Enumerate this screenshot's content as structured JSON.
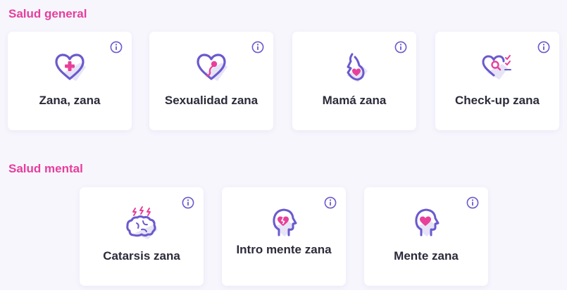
{
  "colors": {
    "background": "#f7f6fd",
    "accent": "#e63e9c",
    "icon_purple": "#6a5acd",
    "icon_pink": "#e8409a",
    "text": "#2b2b3a"
  },
  "sections": {
    "general": {
      "title": "Salud general",
      "cards": [
        {
          "label": "Zana, zana",
          "icon": "heart-cross-icon"
        },
        {
          "label": "Sexualidad zana",
          "icon": "heart-sperm-icon"
        },
        {
          "label": "Mamá zana",
          "icon": "pregnancy-icon"
        },
        {
          "label": "Check-up zana",
          "icon": "heart-checklist-icon"
        }
      ]
    },
    "mental": {
      "title": "Salud mental",
      "cards": [
        {
          "label": "Catarsis zana",
          "icon": "brain-lightning-icon"
        },
        {
          "label": "Intro mente zana",
          "icon": "head-broken-heart-icon"
        },
        {
          "label": "Mente zana",
          "icon": "head-heart-icon"
        }
      ]
    }
  }
}
